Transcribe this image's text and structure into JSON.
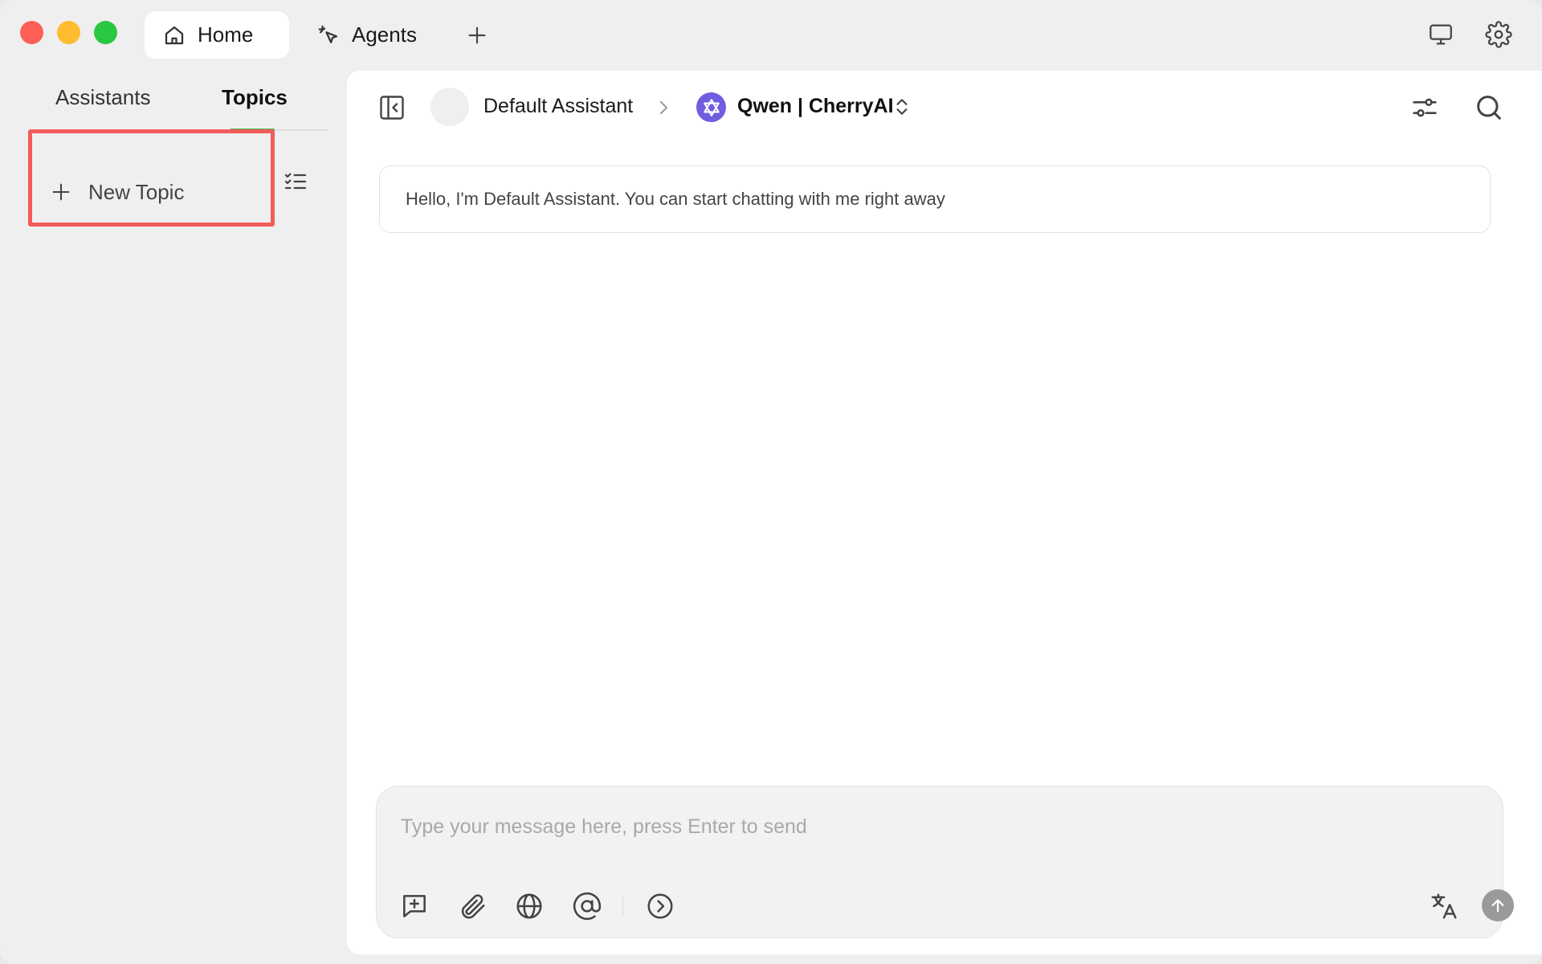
{
  "titlebar": {
    "tabs": [
      {
        "label": "Home",
        "icon": "home-icon",
        "active": true
      },
      {
        "label": "Agents",
        "icon": "cursor-sparkle-icon",
        "active": false
      }
    ],
    "add_tab_icon": "plus-icon",
    "right_icons": [
      "display-icon",
      "gear-icon"
    ]
  },
  "sidebar": {
    "tabs": [
      {
        "label": "Assistants",
        "active": false
      },
      {
        "label": "Topics",
        "active": true
      }
    ],
    "new_topic_label": "New Topic",
    "list_icon": "checklist-icon"
  },
  "header": {
    "assistant_name": "Default Assistant",
    "model_name": "Qwen | CherryAI"
  },
  "chat": {
    "greeting": "Hello, I'm Default Assistant. You can start chatting with me right away"
  },
  "composer": {
    "placeholder": "Type your message here, press Enter to send",
    "value": "",
    "tool_icons": [
      "new-topic-icon",
      "paperclip-icon",
      "globe-icon",
      "at-icon",
      "chevron-right-circle-icon",
      "translate-icon",
      "send-arrow-icon"
    ]
  },
  "colors": {
    "highlight_border": "#f25c5c",
    "active_indicator": "#3fb950",
    "model_logo": "#6f5ee0",
    "close": "#fe5f57",
    "minimize": "#febc2e",
    "maximize": "#28c840"
  }
}
